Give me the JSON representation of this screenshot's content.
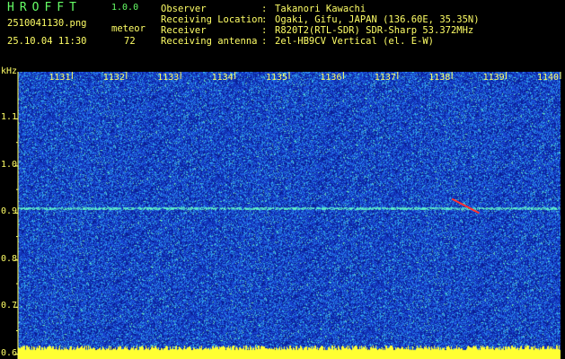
{
  "app": {
    "title": "HROFFT",
    "version": "1.0.0"
  },
  "file": {
    "name": "2510041130.png",
    "timestamp": "25.10.04 11:30"
  },
  "meteor": {
    "label": "meteor",
    "count": "72"
  },
  "station": [
    {
      "label": "Observer",
      "value": "Takanori Kawachi"
    },
    {
      "label": "Receiving Location",
      "value": "Ogaki, Gifu, JAPAN (136.60E, 35.35N)"
    },
    {
      "label": "Receiver",
      "value": "R820T2(RTL-SDR) SDR-Sharp 53.372MHz"
    },
    {
      "label": "Receiving antenna",
      "value": "2el-HB9CV Vertical (el. E-W)"
    }
  ],
  "separator": ":",
  "colors": {
    "text": "#ffff66",
    "title": "#66ff66",
    "background": "#000000",
    "spectrum_base": "#1a3cc8"
  },
  "chart_data": {
    "type": "heatmap",
    "ylabel": "kHz",
    "yticks": [
      "1.1",
      "1.0",
      "0.9",
      "0.8",
      "0.7",
      "0.6"
    ],
    "xticks": [
      "1131",
      "1132",
      "1133",
      "1134",
      "1135",
      "1136",
      "1137",
      "1138",
      "1139",
      "1140"
    ],
    "ylim": [
      0.59,
      1.2
    ],
    "xlim": [
      1130,
      1140
    ],
    "carrier_khz": 0.91,
    "meteor_echo": {
      "x_start": 1138.0,
      "x_end": 1138.5,
      "khz_start": 0.93,
      "khz_end": 0.9
    }
  }
}
